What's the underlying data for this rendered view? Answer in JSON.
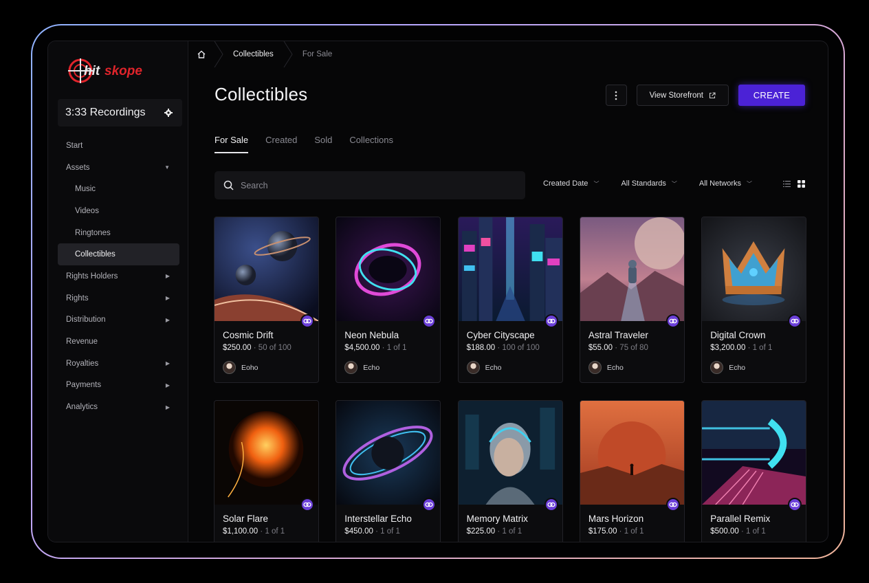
{
  "brand": {
    "logo_text": "hitskope",
    "accent": "#e0242b"
  },
  "workspace": {
    "name": "3:33 Recordings"
  },
  "sidebar": {
    "items": [
      {
        "label": "Start",
        "expandable": false
      },
      {
        "label": "Assets",
        "expandable": true,
        "expanded": true
      },
      {
        "label": "Music",
        "sub": true
      },
      {
        "label": "Videos",
        "sub": true
      },
      {
        "label": "Ringtones",
        "sub": true
      },
      {
        "label": "Collectibles",
        "sub": true,
        "active": true
      },
      {
        "label": "Rights Holders",
        "expandable": true
      },
      {
        "label": "Rights",
        "expandable": true
      },
      {
        "label": "Distribution",
        "expandable": true
      },
      {
        "label": "Revenue",
        "expandable": false
      },
      {
        "label": "Royalties",
        "expandable": true
      },
      {
        "label": "Payments",
        "expandable": true
      },
      {
        "label": "Analytics",
        "expandable": true
      }
    ]
  },
  "breadcrumb": {
    "items": [
      "Collectibles",
      "For Sale"
    ]
  },
  "header": {
    "title": "Collectibles",
    "view_storefront_label": "View Storefront",
    "create_label": "CREATE"
  },
  "tabs": [
    "For Sale",
    "Created",
    "Sold",
    "Collections"
  ],
  "search": {
    "placeholder": "Search",
    "value": ""
  },
  "filters": {
    "sort": "Created Date",
    "standards": "All Standards",
    "networks": "All Networks"
  },
  "colors": {
    "create_button": "#4b22d6",
    "badge": "#6b3fd8"
  },
  "cards": [
    {
      "title": "Cosmic Drift",
      "price": "$250.00",
      "edition": "· 50 of 100",
      "owner": "Eoho",
      "art": "planets"
    },
    {
      "title": "Neon Nebula",
      "price": "$4,500.00",
      "edition": "· 1 of 1",
      "owner": "Echo",
      "art": "nebula"
    },
    {
      "title": "Cyber Cityscape",
      "price": "$188.00",
      "edition": "· 100 of 100",
      "owner": "Echo",
      "art": "city"
    },
    {
      "title": "Astral Traveler",
      "price": "$55.00",
      "edition": "· 75 of 80",
      "owner": "Echo",
      "art": "astronaut"
    },
    {
      "title": "Digital Crown",
      "price": "$3,200.00",
      "edition": "· 1 of 1",
      "owner": "Echo",
      "art": "crown"
    },
    {
      "title": "Solar Flare",
      "price": "$1,100.00",
      "edition": "· 1 of 1",
      "owner": "",
      "art": "sun"
    },
    {
      "title": "Interstellar Echo",
      "price": "$450.00",
      "edition": "· 1 of 1",
      "owner": "",
      "art": "ring-planet"
    },
    {
      "title": "Memory Matrix",
      "price": "$225.00",
      "edition": "· 1 of 1",
      "owner": "",
      "art": "robot"
    },
    {
      "title": "Mars Horizon",
      "price": "$175.00",
      "edition": "· 1 of 1",
      "owner": "",
      "art": "mars"
    },
    {
      "title": "Parallel Remix",
      "price": "$500.00",
      "edition": "· 1 of 1",
      "owner": "",
      "art": "tunnel"
    }
  ]
}
